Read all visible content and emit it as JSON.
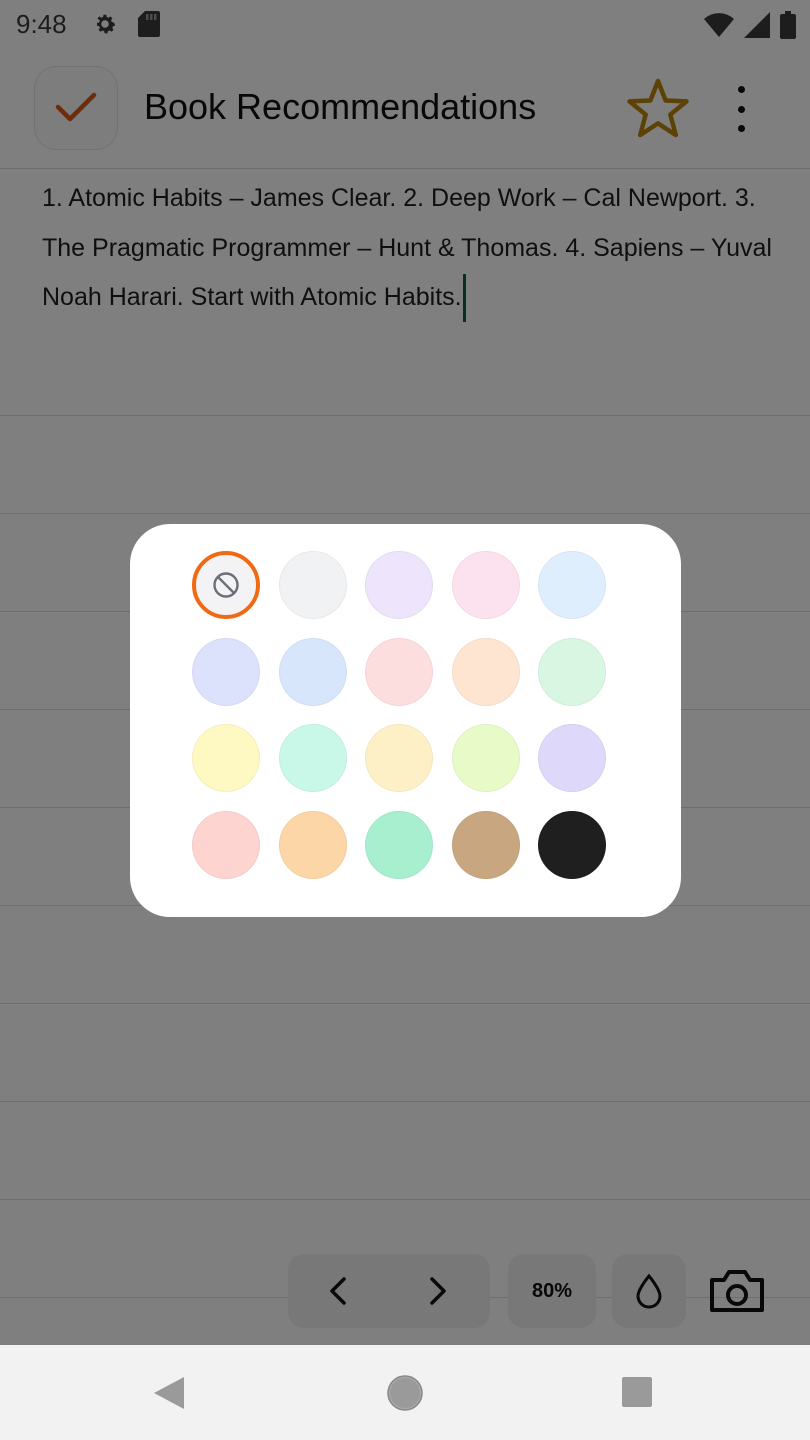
{
  "status_bar": {
    "time": "9:48",
    "icons": [
      "gear-icon",
      "sd-card-icon",
      "wifi-icon",
      "signal-icon",
      "battery-icon"
    ]
  },
  "app_bar": {
    "title": "Book Recommendations",
    "check_icon": "check-icon",
    "star_icon": "star-outline-icon",
    "more_icon": "more-vert-icon",
    "accent_color": "#d85a16",
    "star_color": "#b9860a"
  },
  "note": {
    "text": "1. Atomic Habits – James Clear. 2. Deep Work – Cal Newport. 3. The Pragmatic Programmer – Hunt & Thomas. 4. Sapiens – Yuval Noah Harari. Start with Atomic Habits."
  },
  "toolbar": {
    "prev_icon": "chevron-left-icon",
    "next_icon": "chevron-right-icon",
    "zoom": "80%",
    "drop_icon": "drop-icon",
    "camera_icon": "camera-icon"
  },
  "color_picker": {
    "selected": "none",
    "none_icon": "block-icon",
    "selected_ring_color": "#f06a14",
    "colors": [
      "none",
      "#f1f2f4",
      "#eee4fb",
      "#fbe2ee",
      "#dfeefd",
      "#dde2fc",
      "#d8e6fb",
      "#fddede",
      "#fde5d1",
      "#d9f6e2",
      "#fef8c3",
      "#c9f8e8",
      "#fdf0c7",
      "#e8fac8",
      "#ded8fb",
      "#fdd4cf",
      "#fcd6a6",
      "#a8efd0",
      "#c8a780",
      "#1f1f1f"
    ]
  },
  "system_nav": {
    "icons": [
      "back-triangle-icon",
      "home-circle-icon",
      "recents-square-icon"
    ]
  }
}
